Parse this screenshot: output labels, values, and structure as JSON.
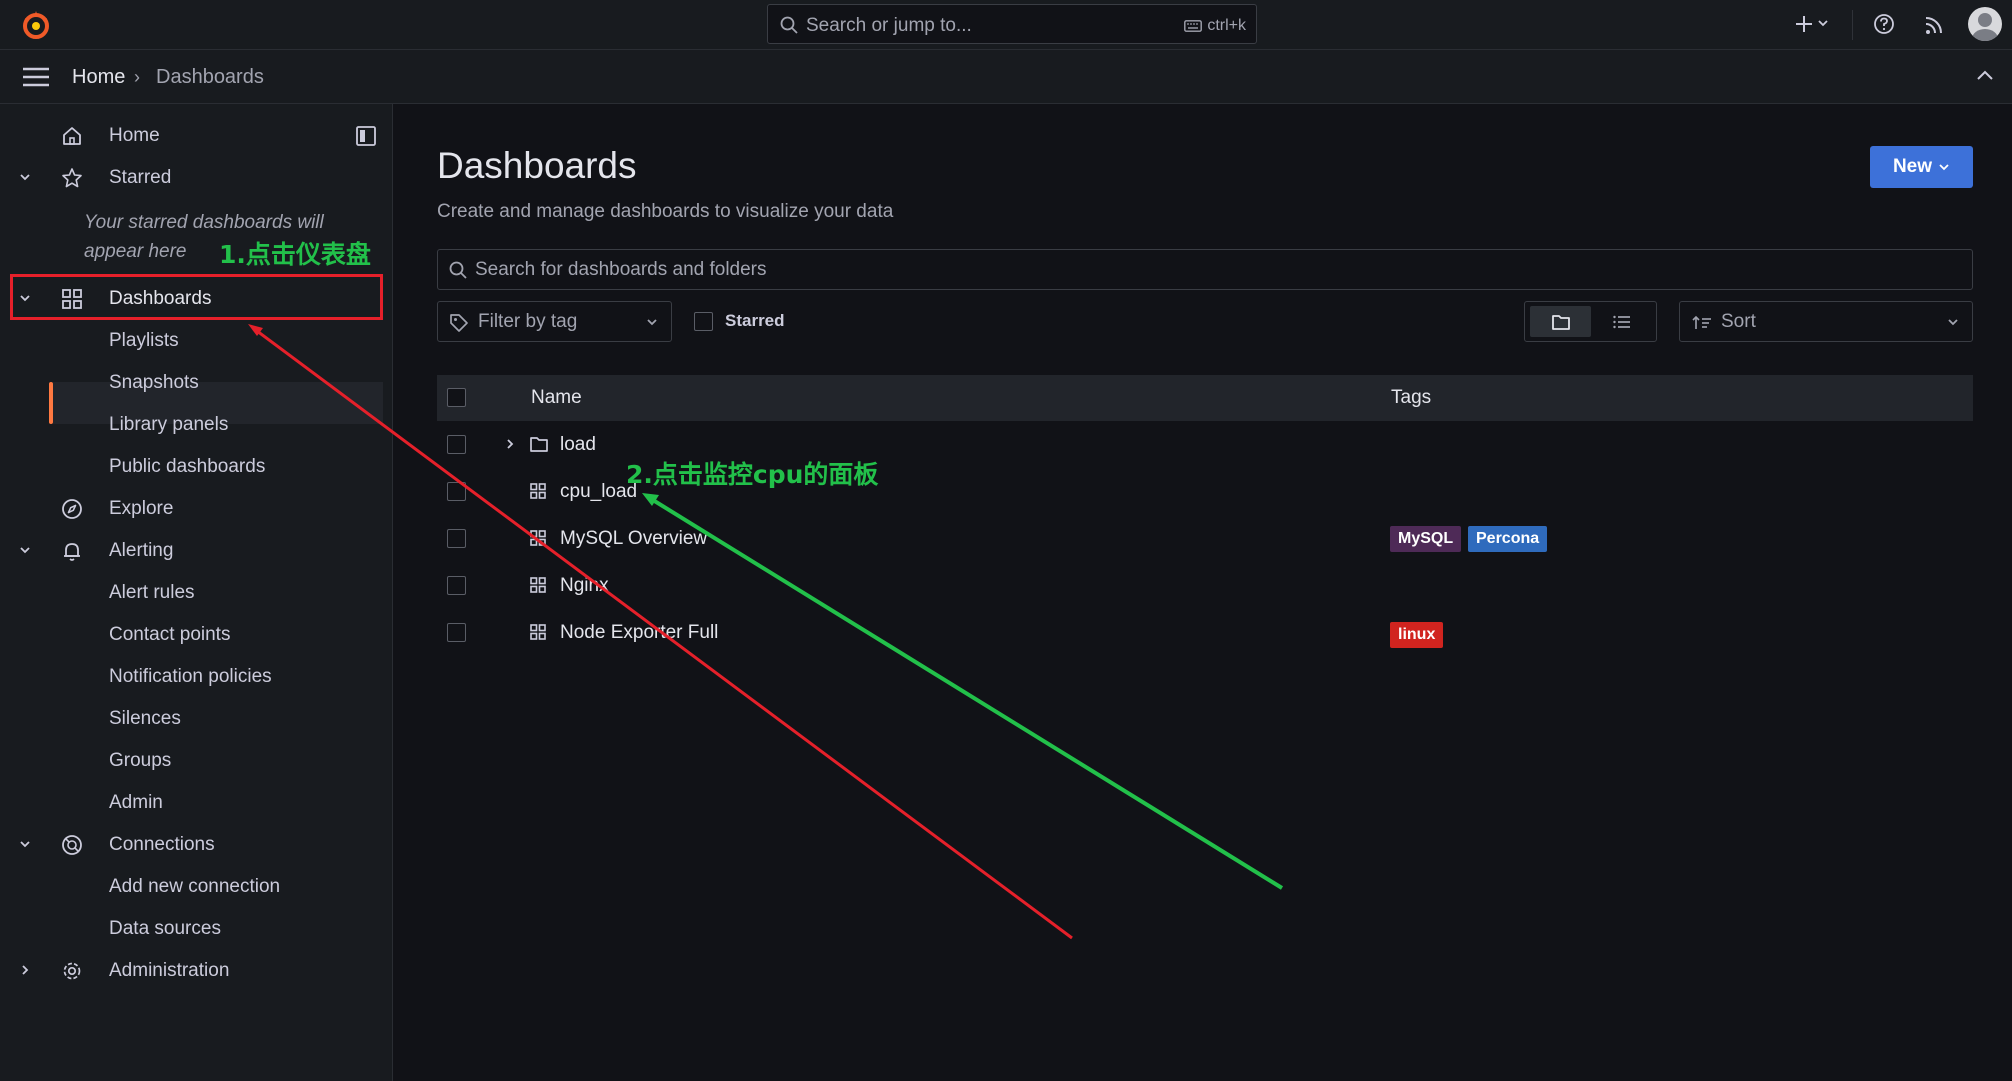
{
  "topbar": {
    "search_placeholder": "Search or jump to...",
    "search_shortcut": "ctrl+k",
    "icons": [
      "grafana-logo",
      "plus-icon",
      "help-icon",
      "rss-icon",
      "user-avatar"
    ]
  },
  "breadcrumb": {
    "home": "Home",
    "separator": "›",
    "current": "Dashboards"
  },
  "sidebar": {
    "home": "Home",
    "starred": "Starred",
    "starred_note": "Your starred dashboards will appear here",
    "dashboards": "Dashboards",
    "dashboards_children": [
      "Playlists",
      "Snapshots",
      "Library panels",
      "Public dashboards"
    ],
    "explore": "Explore",
    "alerting": "Alerting",
    "alerting_children": [
      "Alert rules",
      "Contact points",
      "Notification policies",
      "Silences",
      "Groups",
      "Admin"
    ],
    "connections": "Connections",
    "connections_children": [
      "Add new connection",
      "Data sources"
    ],
    "administration": "Administration"
  },
  "main": {
    "title": "Dashboards",
    "subtitle": "Create and manage dashboards to visualize your data",
    "new_button": "New",
    "search_placeholder": "Search for dashboards and folders",
    "filter_tag_placeholder": "Filter by tag",
    "starred_filter": "Starred",
    "sort_label": "Sort",
    "columns": {
      "name": "Name",
      "tags": "Tags"
    },
    "rows": [
      {
        "type": "folder",
        "name": "load",
        "tags": []
      },
      {
        "type": "dashboard",
        "name": "cpu_load",
        "tags": []
      },
      {
        "type": "dashboard",
        "name": "MySQL Overview",
        "tags": [
          "MySQL",
          "Percona"
        ]
      },
      {
        "type": "dashboard",
        "name": "Nginx",
        "tags": []
      },
      {
        "type": "dashboard",
        "name": "Node Exporter Full",
        "tags": [
          "linux"
        ]
      }
    ]
  },
  "annotations": {
    "step1": "1.点击仪表盘",
    "step2": "2.点击监控cpu的面板"
  },
  "colors": {
    "accent_orange": "#ff7941",
    "primary_blue": "#3d71d9",
    "tag_mysql": "#4e2a57",
    "tag_percona": "#2f6bbd",
    "tag_linux": "#d1241f",
    "annotation_red": "#e5202a",
    "annotation_green": "#22c04a"
  }
}
